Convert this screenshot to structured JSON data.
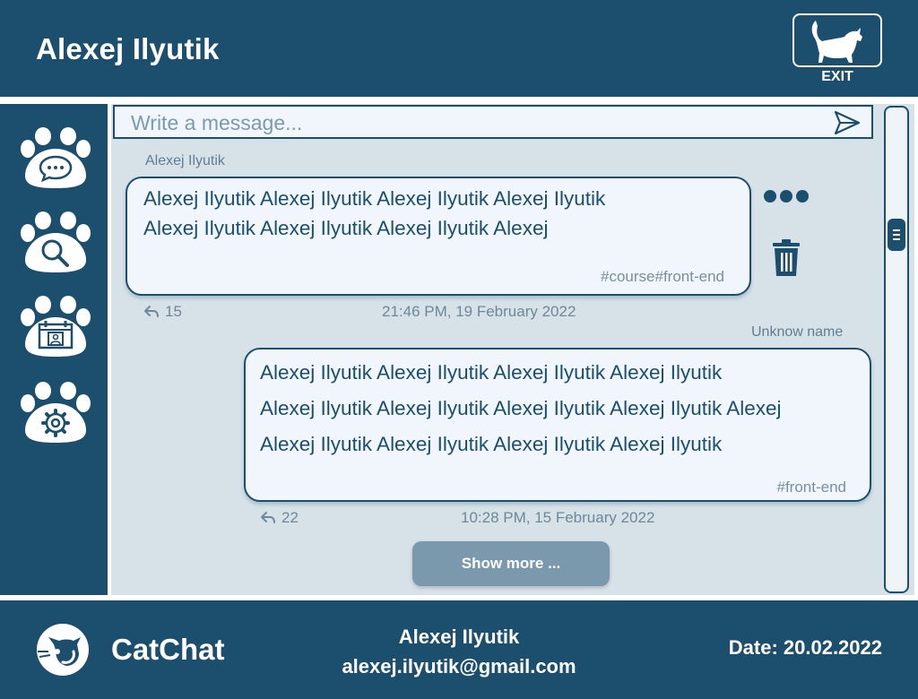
{
  "header": {
    "title": "Alexej Ilyutik",
    "exit_label": "EXIT"
  },
  "sidebar": {
    "items": [
      {
        "icon": "chat-icon"
      },
      {
        "icon": "search-icon"
      },
      {
        "icon": "calendar-icon"
      },
      {
        "icon": "settings-icon"
      }
    ]
  },
  "composer": {
    "placeholder": "Write a message..."
  },
  "messages": [
    {
      "author": "Alexej Ilyutik",
      "lines": [
        "Alexej Ilyutik Alexej Ilyutik Alexej Ilyutik Alexej Ilyutik",
        "Alexej Ilyutik Alexej Ilyutik Alexej Ilyutik Alexej"
      ],
      "tags": "#course#front-end",
      "replies": "15",
      "timestamp": "21:46 PM, 19 February 2022"
    },
    {
      "author": "Unknow name",
      "lines": [
        "Alexej Ilyutik Alexej Ilyutik Alexej Ilyutik Alexej Ilyutik",
        "Alexej Ilyutik Alexej Ilyutik Alexej Ilyutik Alexej Ilyutik Alexej",
        "Alexej Ilyutik Alexej Ilyutik Alexej Ilyutik Alexej Ilyutik"
      ],
      "tags": "#front-end",
      "replies": "22",
      "timestamp": "10:28 PM, 15 February 2022"
    }
  ],
  "show_more_label": "Show more ...",
  "footer": {
    "brand": "CatChat",
    "user_name": "Alexej Ilyutik",
    "user_email": "alexej.ilyutik@gmail.com",
    "date": "Date: 20.02.2022"
  },
  "colors": {
    "primary": "#1c4f6e",
    "background": "#d7e2e8",
    "bubble": "#f0f6fb",
    "button": "#7b99ad"
  }
}
